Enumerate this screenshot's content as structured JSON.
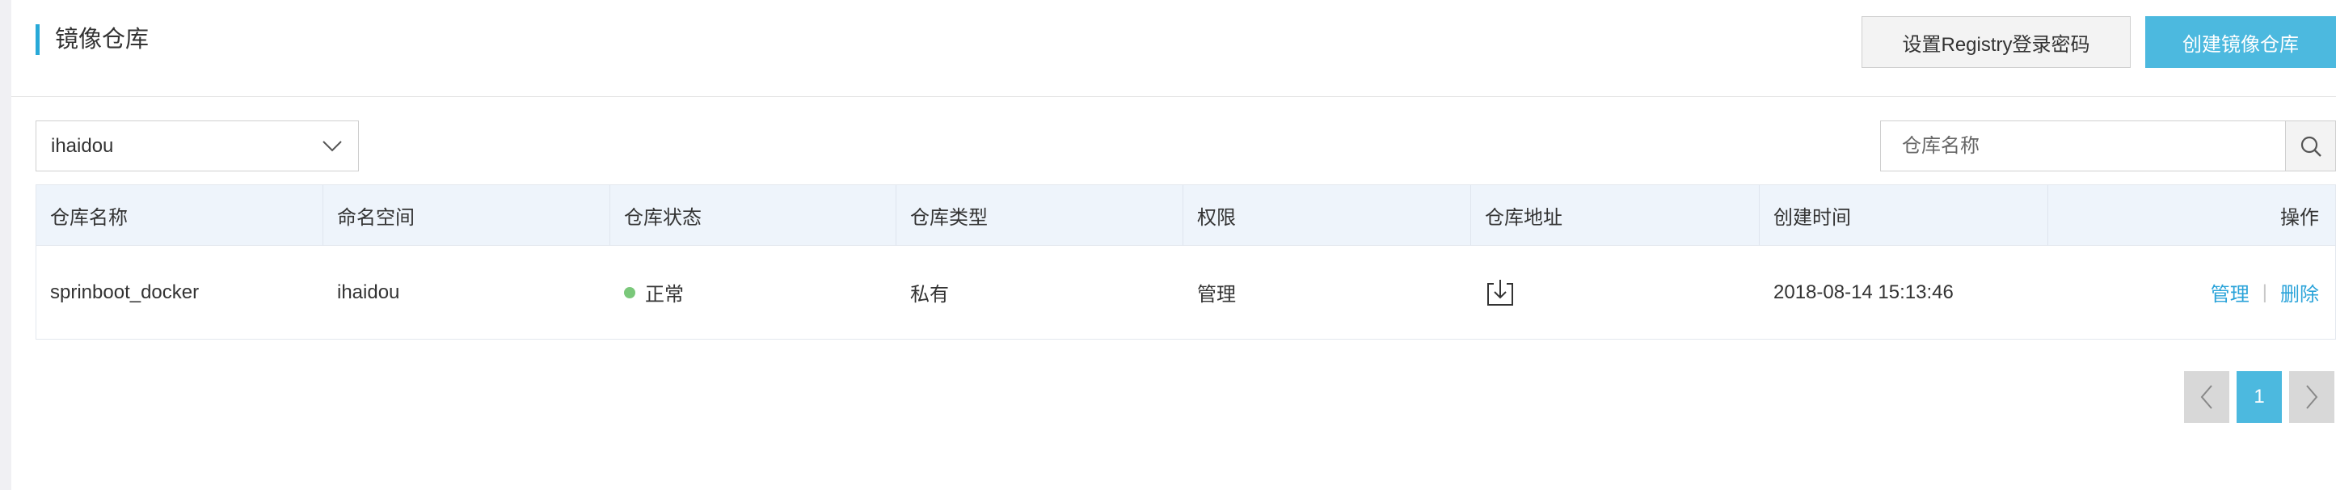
{
  "header": {
    "title": "镜像仓库",
    "registry_password_button": "设置Registry登录密码",
    "create_repo_button": "创建镜像仓库"
  },
  "filters": {
    "namespace_selected": "ihaidou",
    "search_placeholder": "仓库名称",
    "search_value": ""
  },
  "table": {
    "headers": [
      "仓库名称",
      "命名空间",
      "仓库状态",
      "仓库类型",
      "权限",
      "仓库地址",
      "创建时间",
      "操作"
    ],
    "rows": [
      {
        "name": "sprinboot_docker",
        "namespace": "ihaidou",
        "status": "正常",
        "type": "私有",
        "permission": "管理",
        "created": "2018-08-14 15:13:46",
        "action_manage": "管理",
        "action_separator": "|",
        "action_delete": "删除"
      }
    ]
  },
  "pagination": {
    "current_page": "1"
  },
  "colors": {
    "accent": "#4cb9df",
    "title_bar": "#28a9d8",
    "link": "#2aa3d9",
    "status_normal": "#7ac87a",
    "table_header_bg": "#eef4fb"
  },
  "icons": {
    "namespace_dropdown": "chevron-down-icon",
    "search": "search-icon",
    "repo_address": "download-icon",
    "prev": "chevron-left-icon",
    "next": "chevron-right-icon"
  }
}
